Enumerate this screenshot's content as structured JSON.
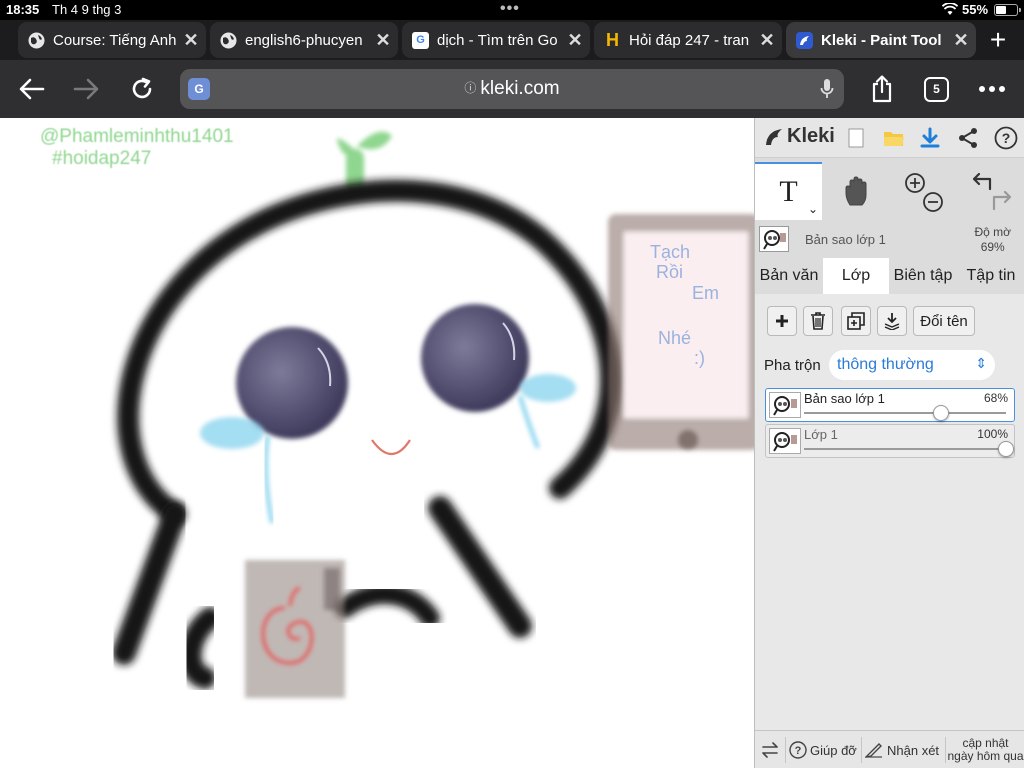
{
  "status_bar": {
    "time": "18:35",
    "date": "Th 4 9 thg 3",
    "battery_percent": "55%",
    "battery_level": 0.55
  },
  "tabs": [
    {
      "label": "Course: Tiếng Anh",
      "favicon": "globe-icon"
    },
    {
      "label": "english6-phucyen",
      "favicon": "globe-icon"
    },
    {
      "label": "dịch - Tìm trên Go",
      "favicon": "google-icon",
      "favicon_text": "G"
    },
    {
      "label": "Hỏi đáp 247 - tran",
      "favicon": "hoidap-icon",
      "favicon_text": "H"
    },
    {
      "label": "Kleki - Paint Tool",
      "favicon": "kleki-icon",
      "active": true
    }
  ],
  "toolbar": {
    "url": "kleki.com",
    "translate_text": "G",
    "tabs_count": "5"
  },
  "canvas": {
    "handle_tag": "@Phamleminhthu1401",
    "hashtag": "#hoidap247",
    "tablet_text": [
      "Tạch",
      "Rồi",
      "Em",
      "Nhé",
      ":)"
    ]
  },
  "panel": {
    "logo": "Kleki",
    "current_layer": "Bản sao lớp 1",
    "opacity_label": "Độ mờ",
    "opacity_value": "69%",
    "nav_tabs": [
      "Bản văn",
      "Lớp",
      "Biên tập",
      "Tập tin"
    ],
    "active_nav": 1,
    "rename_label": "Đổi tên",
    "blend_label": "Pha trộn",
    "blend_value": "thông thường",
    "layers": [
      {
        "name": "Bản sao lớp 1",
        "opacity": "68%",
        "opacity_value": 0.68,
        "selected": true
      },
      {
        "name": "Lớp 1",
        "opacity": "100%",
        "opacity_value": 1.0,
        "selected": false
      }
    ],
    "bottom": {
      "help_label": "Giúp đỡ",
      "feedback_label": "Nhận xét",
      "update_line1": "cập nhật",
      "update_line2": "ngày hôm qua"
    }
  },
  "colors": {
    "accent": "#2b7bd8",
    "panel_bg": "#dcdcdc",
    "toolbar_bg": "#2f2f31",
    "tabbar_bg": "#1c1c1e"
  }
}
